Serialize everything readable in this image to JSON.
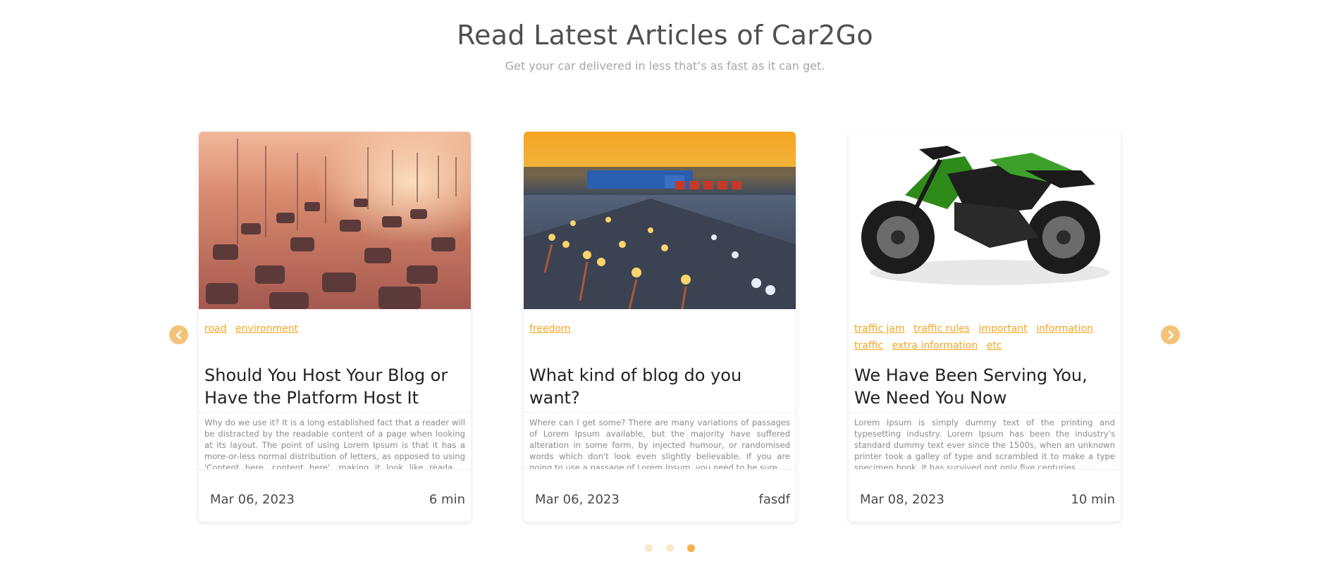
{
  "section": {
    "title": "Read Latest Articles of Car2Go",
    "subtitle": "Get your car delivered in less that’s as fast as it can get."
  },
  "navigation": {
    "prev_icon": "chevron-left-icon",
    "next_icon": "chevron-right-icon",
    "accent_color": "#f5c27a"
  },
  "cards": [
    {
      "image_alt": "sunset highway traffic",
      "tags": [
        "road",
        "environment"
      ],
      "title": "Should You Host Your Blog or Have the Platform Host It",
      "excerpt": "Why do we use it? It is a long established fact that a reader will be distracted by the readable content of a page when looking at its layout. The point of using Lorem Ipsum is that it has a more-or-less normal distribution of letters, as opposed to using 'Content here, content here', making it look like readable English.",
      "date": "Mar 06, 2023",
      "meta": "6 min"
    },
    {
      "image_alt": "highway at dusk with overhead signs",
      "tags": [
        "freedom"
      ],
      "title": "What kind of blog do you want?",
      "excerpt": "Where can I get some? There are many variations of passages of Lorem Ipsum available, but the majority have suffered alteration in some form, by injected humour, or randomised words which don't look even slightly believable. If you are going to use a passage of Lorem Ipsum, you need to be sure.",
      "date": "Mar 06, 2023",
      "meta": "fasdf"
    },
    {
      "image_alt": "green motorcycle",
      "tags": [
        "traffic jam",
        "traffic rules",
        "important",
        "information",
        "traffic",
        "extra information",
        "etc"
      ],
      "title": "We Have Been Serving You, We Need You Now",
      "excerpt": "Lorem Ipsum is simply dummy text of the printing and typesetting industry. Lorem Ipsum has been the industry's standard dummy text ever since the 1500s, when an unknown printer took a galley of type and scrambled it to make a type specimen book. It has survived not only five centuries.",
      "date": "Mar 08, 2023",
      "meta": "10 min"
    }
  ],
  "pagination": {
    "count": 3,
    "active_index": 2,
    "active_color": "#f5b04c"
  }
}
